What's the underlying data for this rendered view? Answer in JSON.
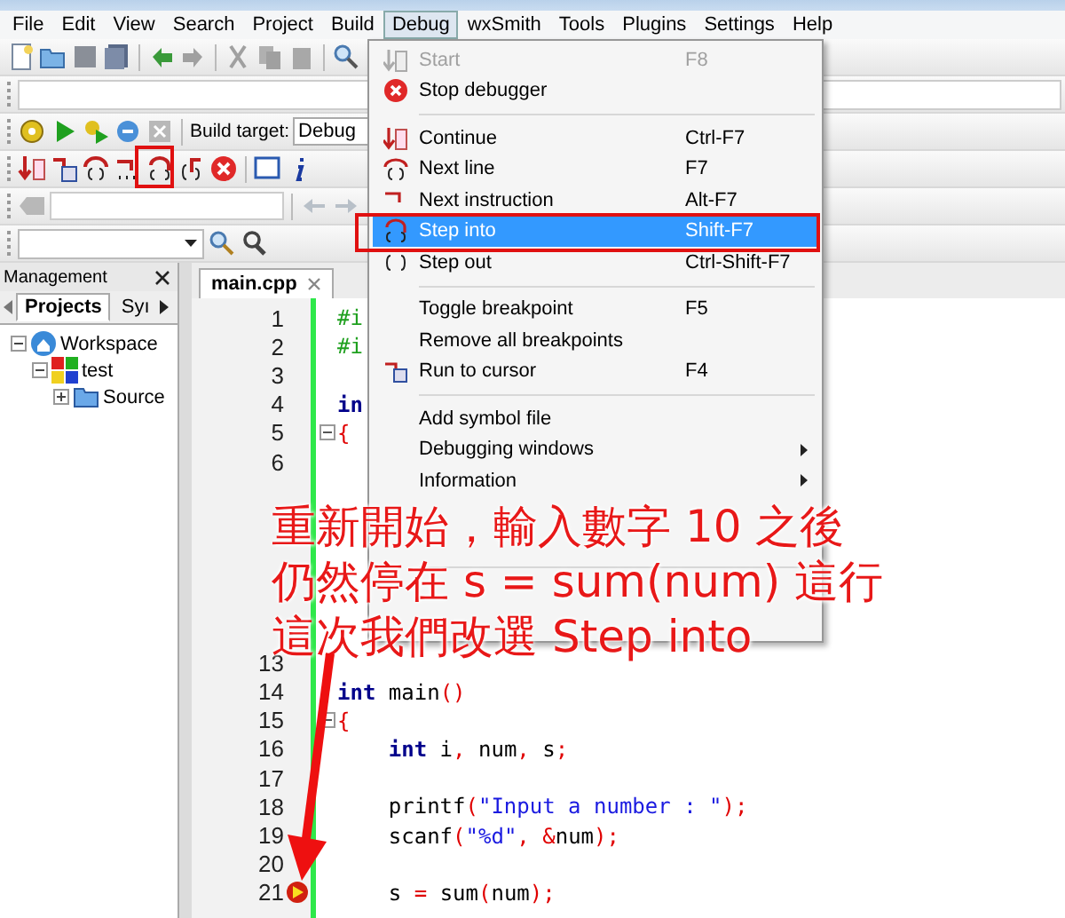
{
  "menu_bar": [
    {
      "label": "File",
      "selected": false
    },
    {
      "label": "Edit",
      "selected": false
    },
    {
      "label": "View",
      "selected": false
    },
    {
      "label": "Search",
      "selected": false
    },
    {
      "label": "Project",
      "selected": false
    },
    {
      "label": "Build",
      "selected": false
    },
    {
      "label": "Debug",
      "selected": true
    },
    {
      "label": "wxSmith",
      "selected": false
    },
    {
      "label": "Tools",
      "selected": false
    },
    {
      "label": "Plugins",
      "selected": false
    },
    {
      "label": "Settings",
      "selected": false
    },
    {
      "label": "Help",
      "selected": false
    }
  ],
  "build_target": {
    "label": "Build target:",
    "value": "Debug"
  },
  "management": {
    "title": "Management",
    "tabs": [
      {
        "label": "Projects",
        "selected": true
      },
      {
        "label": "Syı",
        "selected": false
      }
    ],
    "tree": [
      {
        "label": "Workspace",
        "kind": "workspace",
        "expanded": true,
        "children": [
          {
            "label": "test",
            "kind": "project",
            "expanded": true,
            "children": [
              {
                "label": "Source",
                "kind": "folder",
                "expanded": false
              }
            ]
          }
        ]
      }
    ]
  },
  "editor": {
    "tab": "main.cpp",
    "lines": [
      {
        "number": "1",
        "tokens": [
          {
            "kind": "pre",
            "text": "#i"
          }
        ]
      },
      {
        "number": "2",
        "tokens": [
          {
            "kind": "pre",
            "text": "#i"
          }
        ]
      },
      {
        "number": "3"
      },
      {
        "number": "4",
        "tokens": [
          {
            "kind": "kw",
            "text": "in"
          }
        ]
      },
      {
        "number": "5",
        "tokens": [
          {
            "kind": "op",
            "text": "{"
          }
        ],
        "fold": true
      },
      {
        "number": "6"
      }
    ],
    "lines_below_note": [
      {
        "number": "13"
      },
      {
        "number": "14",
        "tokens": [
          {
            "kind": "kw",
            "text": "int"
          },
          {
            "kind": "plain",
            "text": " main"
          },
          {
            "kind": "op",
            "text": "()"
          }
        ]
      },
      {
        "number": "15",
        "tokens": [
          {
            "kind": "op",
            "text": "{"
          }
        ],
        "fold": true
      },
      {
        "number": "16",
        "tokens": [
          {
            "kind": "kw",
            "text": "    int"
          },
          {
            "kind": "plain",
            "text": " i"
          },
          {
            "kind": "op",
            "text": ","
          },
          {
            "kind": "plain",
            "text": " num"
          },
          {
            "kind": "op",
            "text": ","
          },
          {
            "kind": "plain",
            "text": " s"
          },
          {
            "kind": "op",
            "text": ";"
          }
        ]
      },
      {
        "number": "17"
      },
      {
        "number": "18",
        "tokens": [
          {
            "kind": "plain",
            "text": "    printf"
          },
          {
            "kind": "op",
            "text": "("
          },
          {
            "kind": "str",
            "text": "\"Input a number : \""
          },
          {
            "kind": "op",
            "text": ");"
          }
        ]
      },
      {
        "number": "19",
        "tokens": [
          {
            "kind": "plain",
            "text": "    scanf"
          },
          {
            "kind": "op",
            "text": "("
          },
          {
            "kind": "str",
            "text": "\"%d\""
          },
          {
            "kind": "op",
            "text": ", &"
          },
          {
            "kind": "plain",
            "text": "num"
          },
          {
            "kind": "op",
            "text": ");"
          }
        ]
      },
      {
        "number": "20"
      },
      {
        "number": "21",
        "tokens": [
          {
            "kind": "plain",
            "text": "    s "
          },
          {
            "kind": "op",
            "text": "="
          },
          {
            "kind": "plain",
            "text": " sum"
          },
          {
            "kind": "op",
            "text": "("
          },
          {
            "kind": "plain",
            "text": "num"
          },
          {
            "kind": "op",
            "text": ");"
          }
        ],
        "current": true
      }
    ]
  },
  "debug_menu": [
    {
      "kind": "item",
      "label": "Start",
      "shortcut": "F8",
      "disabled": true,
      "selected": false
    },
    {
      "kind": "item",
      "label": "Stop debugger",
      "disabled": false,
      "selected": false
    },
    {
      "kind": "separator"
    },
    {
      "kind": "item",
      "label": "Continue",
      "shortcut": "Ctrl-F7",
      "disabled": false,
      "selected": false
    },
    {
      "kind": "item",
      "label": "Next line",
      "shortcut": "F7",
      "disabled": false,
      "selected": false
    },
    {
      "kind": "item",
      "label": "Next instruction",
      "shortcut": "Alt-F7",
      "disabled": false,
      "selected": false
    },
    {
      "kind": "item",
      "label": "Step into",
      "shortcut": "Shift-F7",
      "disabled": false,
      "selected": true
    },
    {
      "kind": "item",
      "label": "Step out",
      "shortcut": "Ctrl-Shift-F7",
      "disabled": false,
      "selected": false
    },
    {
      "kind": "separator"
    },
    {
      "kind": "item",
      "label": "Toggle breakpoint",
      "shortcut": "F5",
      "disabled": false,
      "selected": false
    },
    {
      "kind": "item",
      "label": "Remove all breakpoints",
      "disabled": false,
      "selected": false
    },
    {
      "kind": "item",
      "label": "Run to cursor",
      "shortcut": "F4",
      "disabled": false,
      "selected": false
    },
    {
      "kind": "separator"
    },
    {
      "kind": "item",
      "label": "Add symbol file",
      "disabled": false,
      "selected": false
    },
    {
      "kind": "submenu",
      "label": "Debugging windows",
      "disabled": false,
      "selected": false
    },
    {
      "kind": "submenu",
      "label": "Information",
      "disabled": false,
      "selected": false
    },
    {
      "kind": "blank"
    },
    {
      "kind": "blank"
    },
    {
      "kind": "separator"
    },
    {
      "kind": "blank"
    },
    {
      "kind": "blank"
    }
  ],
  "annotation": {
    "lines": [
      "重新開始，輸入數字 10 之後",
      "仍然停在 s = sum(num) 這行",
      "這次我們改選 Step into"
    ]
  }
}
